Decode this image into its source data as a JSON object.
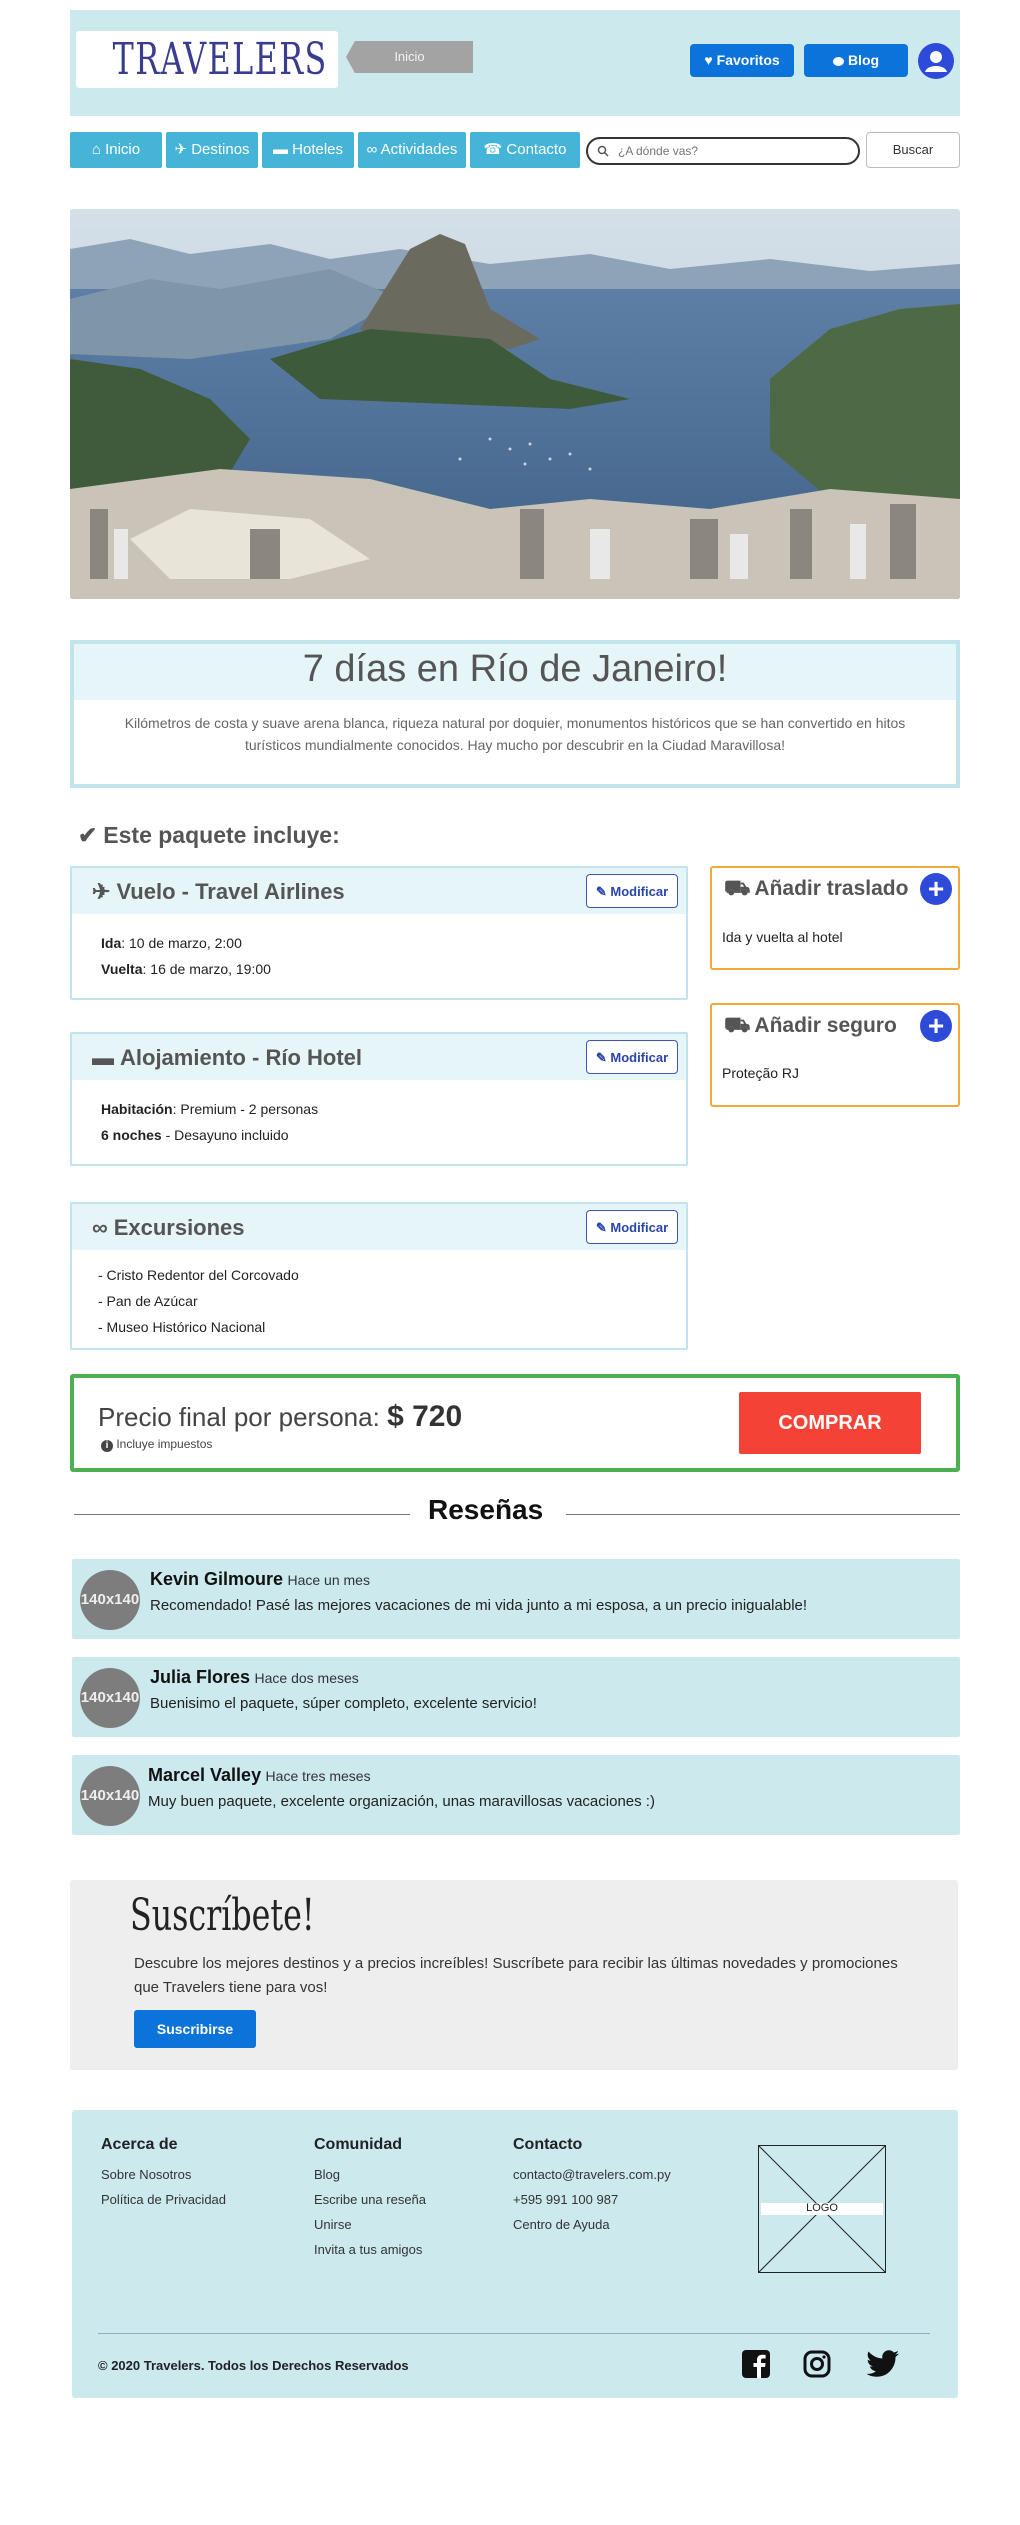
{
  "header": {
    "logo": "TRAVELERS",
    "breadcrumb": "Inicio",
    "favorites_label": "Favoritos",
    "blog_label": "Blog"
  },
  "nav": {
    "items": [
      {
        "label": "Inicio",
        "icon": "home-icon"
      },
      {
        "label": "Destinos",
        "icon": "plane-icon"
      },
      {
        "label": "Hoteles",
        "icon": "bed-icon"
      },
      {
        "label": "Actividades",
        "icon": "bicycle-icon"
      },
      {
        "label": "Contacto",
        "icon": "phone-icon"
      }
    ],
    "search_placeholder": "¿A dónde vas?",
    "search_button": "Buscar"
  },
  "package": {
    "title": "7 días en Río de Janeiro!",
    "description": "Kilómetros de costa y suave arena blanca, riqueza natural por doquier, monumentos históricos que se han convertido en hitos turísticos mundialmente conocidos. Hay mucho por descubrir en la Ciudad Maravillosa!",
    "includes_heading": "Este paquete incluye:"
  },
  "cards": {
    "modify_label": "Modificar",
    "flight": {
      "title": "Vuelo - Travel Airlines",
      "ida_label": "Ida",
      "ida_value": ": 10 de marzo, 2:00",
      "vuelta_label": "Vuelta",
      "vuelta_value": ": 16 de marzo, 19:00"
    },
    "hotel": {
      "title": "Alojamiento - Río Hotel",
      "room_label": "Habitación",
      "room_value": ": Premium - 2 personas",
      "nights_label": "6 noches",
      "nights_value": " - Desayuno incluido"
    },
    "excursions": {
      "title": "Excursiones",
      "items": [
        "- Cristo Redentor del Corcovado",
        "- Pan de Azúcar",
        "- Museo Histórico Nacional"
      ]
    }
  },
  "addons": {
    "transfer": {
      "title": "Añadir traslado",
      "text": "Ida y vuelta al hotel"
    },
    "insurance": {
      "title": "Añadir seguro",
      "text": "Proteção RJ"
    }
  },
  "price": {
    "label": "Precio final por persona:",
    "value": "$ 720",
    "note": "Incluye impuestos",
    "buy_label": "COMPRAR"
  },
  "reviews": {
    "heading": "Reseñas",
    "avatar_placeholder": "140x140",
    "items": [
      {
        "name": "Kevin Gilmoure",
        "when": "Hace un mes",
        "text": "Recomendado! Pasé las mejores vacaciones de mi vida junto a mi esposa, a un precio inigualable!"
      },
      {
        "name": "Julia Flores",
        "when": "Hace dos meses",
        "text": "Buenisimo el paquete, súper completo, excelente servicio!"
      },
      {
        "name": "Marcel Valley",
        "when": "Hace tres meses",
        "text": "Muy buen paquete, excelente organización, unas maravillosas vacaciones :)"
      }
    ]
  },
  "subscribe": {
    "title": "Suscríbete!",
    "text": "Descubre los mejores destinos y a precios increíbles! Suscríbete para recibir las últimas novedades y promociones que Travelers tiene para vos!",
    "button": "Suscribirse"
  },
  "footer": {
    "about": {
      "heading": "Acerca de",
      "links": [
        "Sobre Nosotros",
        "Política de Privacidad"
      ]
    },
    "community": {
      "heading": "Comunidad",
      "links": [
        "Blog",
        "Escribe una reseña",
        "Unirse",
        "Invita a tus amigos"
      ]
    },
    "contact": {
      "heading": "Contacto",
      "links": [
        "contacto@travelers.com.py",
        "+595 991 100 987",
        "Centro de Ayuda"
      ]
    },
    "logo_label": "LOGO",
    "copyright": "© 2020 Travelers. Todos los Derechos Reservados",
    "social": [
      "facebook-icon",
      "instagram-icon",
      "twitter-icon"
    ]
  },
  "colors": {
    "header_bg": "#cce9ed",
    "nav_button": "#45b4d6",
    "primary_blue": "#0b73d9",
    "buy_red": "#f44336",
    "price_border": "#4caf50",
    "addon_border": "#f0a93a"
  }
}
